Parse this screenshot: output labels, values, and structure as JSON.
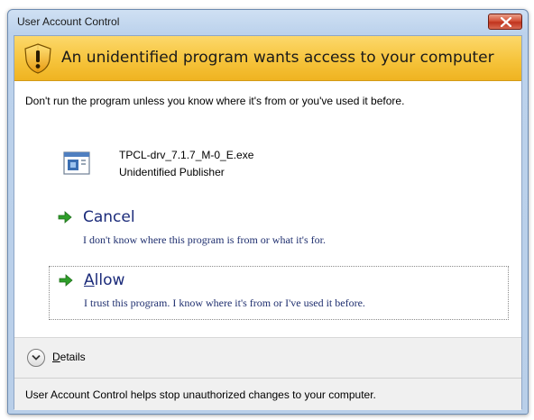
{
  "window": {
    "title": "User Account Control",
    "close_icon": "close-icon"
  },
  "banner": {
    "icon": "shield-warning-icon",
    "message": "An unidentified program wants access to your computer",
    "color": "#f6c43c"
  },
  "warning": {
    "text": "Don't run the program unless you know where it's from or you've used it before."
  },
  "program": {
    "icon": "program-window-icon",
    "name": "TPCL-drv_7.1.7_M-0_E.exe",
    "publisher": "Unidentified Publisher"
  },
  "options": [
    {
      "id": "cancel",
      "icon": "green-arrow-icon",
      "title": "Cancel",
      "description": "I don't know where this program is from or what it's for."
    },
    {
      "id": "allow",
      "icon": "green-arrow-icon",
      "title_accel": "A",
      "title_rest": "llow",
      "description": "I trust this program. I know where it's from or I've used it before."
    }
  ],
  "details": {
    "icon": "chevron-down-icon",
    "label_accel": "D",
    "label_rest": "etails"
  },
  "footer": {
    "text": "User Account Control helps stop unauthorized changes to your computer."
  }
}
